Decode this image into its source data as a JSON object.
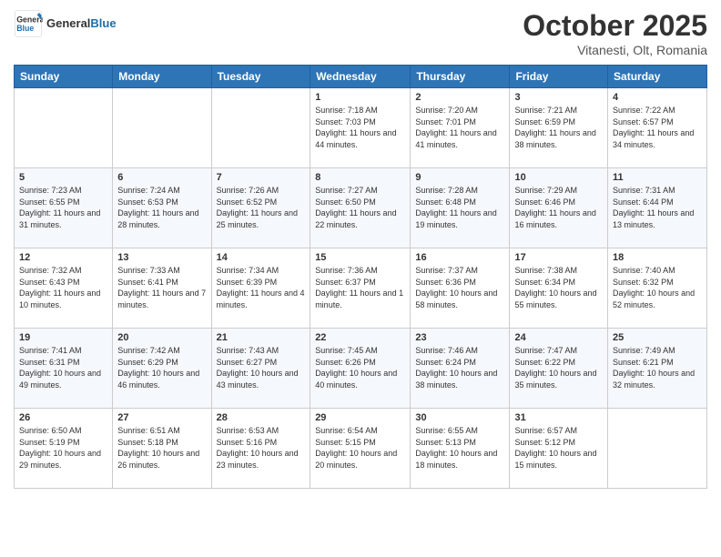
{
  "header": {
    "logo_line1": "General",
    "logo_line2": "Blue",
    "month": "October 2025",
    "location": "Vitanesti, Olt, Romania"
  },
  "weekdays": [
    "Sunday",
    "Monday",
    "Tuesday",
    "Wednesday",
    "Thursday",
    "Friday",
    "Saturday"
  ],
  "weeks": [
    [
      {
        "day": "",
        "info": ""
      },
      {
        "day": "",
        "info": ""
      },
      {
        "day": "",
        "info": ""
      },
      {
        "day": "1",
        "info": "Sunrise: 7:18 AM\nSunset: 7:03 PM\nDaylight: 11 hours and 44 minutes."
      },
      {
        "day": "2",
        "info": "Sunrise: 7:20 AM\nSunset: 7:01 PM\nDaylight: 11 hours and 41 minutes."
      },
      {
        "day": "3",
        "info": "Sunrise: 7:21 AM\nSunset: 6:59 PM\nDaylight: 11 hours and 38 minutes."
      },
      {
        "day": "4",
        "info": "Sunrise: 7:22 AM\nSunset: 6:57 PM\nDaylight: 11 hours and 34 minutes."
      }
    ],
    [
      {
        "day": "5",
        "info": "Sunrise: 7:23 AM\nSunset: 6:55 PM\nDaylight: 11 hours and 31 minutes."
      },
      {
        "day": "6",
        "info": "Sunrise: 7:24 AM\nSunset: 6:53 PM\nDaylight: 11 hours and 28 minutes."
      },
      {
        "day": "7",
        "info": "Sunrise: 7:26 AM\nSunset: 6:52 PM\nDaylight: 11 hours and 25 minutes."
      },
      {
        "day": "8",
        "info": "Sunrise: 7:27 AM\nSunset: 6:50 PM\nDaylight: 11 hours and 22 minutes."
      },
      {
        "day": "9",
        "info": "Sunrise: 7:28 AM\nSunset: 6:48 PM\nDaylight: 11 hours and 19 minutes."
      },
      {
        "day": "10",
        "info": "Sunrise: 7:29 AM\nSunset: 6:46 PM\nDaylight: 11 hours and 16 minutes."
      },
      {
        "day": "11",
        "info": "Sunrise: 7:31 AM\nSunset: 6:44 PM\nDaylight: 11 hours and 13 minutes."
      }
    ],
    [
      {
        "day": "12",
        "info": "Sunrise: 7:32 AM\nSunset: 6:43 PM\nDaylight: 11 hours and 10 minutes."
      },
      {
        "day": "13",
        "info": "Sunrise: 7:33 AM\nSunset: 6:41 PM\nDaylight: 11 hours and 7 minutes."
      },
      {
        "day": "14",
        "info": "Sunrise: 7:34 AM\nSunset: 6:39 PM\nDaylight: 11 hours and 4 minutes."
      },
      {
        "day": "15",
        "info": "Sunrise: 7:36 AM\nSunset: 6:37 PM\nDaylight: 11 hours and 1 minute."
      },
      {
        "day": "16",
        "info": "Sunrise: 7:37 AM\nSunset: 6:36 PM\nDaylight: 10 hours and 58 minutes."
      },
      {
        "day": "17",
        "info": "Sunrise: 7:38 AM\nSunset: 6:34 PM\nDaylight: 10 hours and 55 minutes."
      },
      {
        "day": "18",
        "info": "Sunrise: 7:40 AM\nSunset: 6:32 PM\nDaylight: 10 hours and 52 minutes."
      }
    ],
    [
      {
        "day": "19",
        "info": "Sunrise: 7:41 AM\nSunset: 6:31 PM\nDaylight: 10 hours and 49 minutes."
      },
      {
        "day": "20",
        "info": "Sunrise: 7:42 AM\nSunset: 6:29 PM\nDaylight: 10 hours and 46 minutes."
      },
      {
        "day": "21",
        "info": "Sunrise: 7:43 AM\nSunset: 6:27 PM\nDaylight: 10 hours and 43 minutes."
      },
      {
        "day": "22",
        "info": "Sunrise: 7:45 AM\nSunset: 6:26 PM\nDaylight: 10 hours and 40 minutes."
      },
      {
        "day": "23",
        "info": "Sunrise: 7:46 AM\nSunset: 6:24 PM\nDaylight: 10 hours and 38 minutes."
      },
      {
        "day": "24",
        "info": "Sunrise: 7:47 AM\nSunset: 6:22 PM\nDaylight: 10 hours and 35 minutes."
      },
      {
        "day": "25",
        "info": "Sunrise: 7:49 AM\nSunset: 6:21 PM\nDaylight: 10 hours and 32 minutes."
      }
    ],
    [
      {
        "day": "26",
        "info": "Sunrise: 6:50 AM\nSunset: 5:19 PM\nDaylight: 10 hours and 29 minutes."
      },
      {
        "day": "27",
        "info": "Sunrise: 6:51 AM\nSunset: 5:18 PM\nDaylight: 10 hours and 26 minutes."
      },
      {
        "day": "28",
        "info": "Sunrise: 6:53 AM\nSunset: 5:16 PM\nDaylight: 10 hours and 23 minutes."
      },
      {
        "day": "29",
        "info": "Sunrise: 6:54 AM\nSunset: 5:15 PM\nDaylight: 10 hours and 20 minutes."
      },
      {
        "day": "30",
        "info": "Sunrise: 6:55 AM\nSunset: 5:13 PM\nDaylight: 10 hours and 18 minutes."
      },
      {
        "day": "31",
        "info": "Sunrise: 6:57 AM\nSunset: 5:12 PM\nDaylight: 10 hours and 15 minutes."
      },
      {
        "day": "",
        "info": ""
      }
    ]
  ]
}
